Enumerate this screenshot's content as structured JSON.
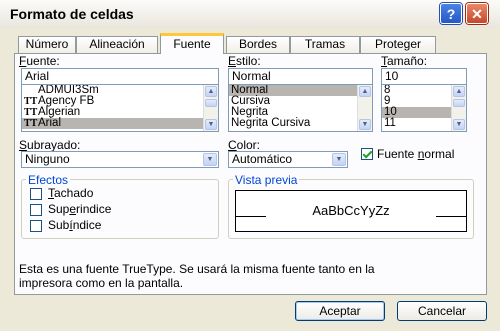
{
  "window": {
    "title": "Formato de celdas"
  },
  "tabs": [
    {
      "label": "Número"
    },
    {
      "label": "Alineación"
    },
    {
      "label": "Fuente"
    },
    {
      "label": "Bordes"
    },
    {
      "label": "Tramas"
    },
    {
      "label": "Proteger"
    }
  ],
  "font": {
    "label_prefix": "F",
    "label_rest": "uente:",
    "value": "Arial",
    "items": [
      {
        "name": "ADMUI3Sm",
        "icon": "none"
      },
      {
        "name": "Agency FB",
        "icon": "truetype-icon"
      },
      {
        "name": "Algerian",
        "icon": "truetype-icon"
      },
      {
        "name": "Arial",
        "icon": "truetype-icon",
        "selected": true
      }
    ]
  },
  "style": {
    "label_prefix": "E",
    "label_rest": "stilo:",
    "value": "Normal",
    "items": [
      {
        "name": "Normal",
        "selected": true
      },
      {
        "name": "Cursiva"
      },
      {
        "name": "Negrita"
      },
      {
        "name": "Negrita Cursiva"
      }
    ]
  },
  "size": {
    "label_prefix": "T",
    "label_rest": "amaño:",
    "value": "10",
    "items": [
      {
        "name": "8"
      },
      {
        "name": "9"
      },
      {
        "name": "10",
        "selected": true
      },
      {
        "name": "11"
      }
    ]
  },
  "underline": {
    "label_prefix": "S",
    "label_rest": "ubrayado:",
    "value": "Ninguno"
  },
  "color": {
    "label_prefix": "C",
    "label_rest": "olor:",
    "value": "Automático"
  },
  "normal_font": {
    "label_a": "Fuente ",
    "label_u": "n",
    "label_b": "ormal",
    "checked": true
  },
  "effects": {
    "legend": "Efectos",
    "items": [
      {
        "pre": "",
        "u": "T",
        "post": "achado"
      },
      {
        "pre": "Sup",
        "u": "e",
        "post": "rindice"
      },
      {
        "pre": "Sub",
        "u": "í",
        "post": "ndice"
      }
    ]
  },
  "preview": {
    "legend": "Vista previa",
    "sample": "AaBbCcYyZz"
  },
  "info_text_line1": "Esta es una fuente TrueType. Se usará la misma fuente tanto en la",
  "info_text_line2": "impresora como en la pantalla.",
  "buttons": {
    "ok": "Aceptar",
    "cancel": "Cancelar"
  },
  "colors": {
    "accent_tab": "#ffc83c",
    "legend_text": "#0046d5",
    "check": "#21a121"
  }
}
